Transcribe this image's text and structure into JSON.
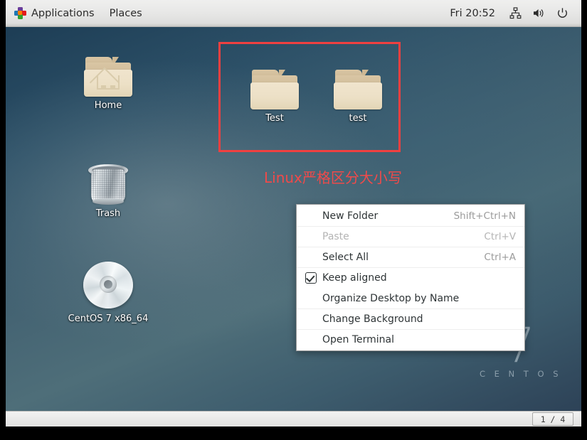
{
  "top_panel": {
    "applications_label": "Applications",
    "places_label": "Places",
    "clock": "Fri 20:52",
    "tray": [
      {
        "name": "network-icon",
        "title": "Network"
      },
      {
        "name": "volume-icon",
        "title": "Volume"
      },
      {
        "name": "power-icon",
        "title": "Power"
      }
    ]
  },
  "desktop": {
    "icons": [
      {
        "name": "home",
        "label": "Home",
        "type": "folder-home"
      },
      {
        "name": "trash",
        "label": "Trash",
        "type": "trash"
      },
      {
        "name": "centos-disc",
        "label": "CentOS 7 x86_64",
        "type": "cd"
      },
      {
        "name": "test-upper",
        "label": "Test",
        "type": "folder"
      },
      {
        "name": "test-lower",
        "label": "test",
        "type": "folder"
      }
    ],
    "annotation": {
      "text": "Linux严格区分大小写",
      "color": "#f04a4a",
      "rect_color": "#f04040"
    },
    "watermark": {
      "version": "7",
      "brand": "C E N T O S"
    }
  },
  "context_menu": {
    "items": [
      {
        "label": "New Folder",
        "accel": "Shift+Ctrl+N",
        "disabled": false,
        "checkbox": null
      },
      {
        "label": "Paste",
        "accel": "Ctrl+V",
        "disabled": true,
        "checkbox": null
      },
      {
        "label": "Select All",
        "accel": "Ctrl+A",
        "disabled": false,
        "checkbox": null
      },
      {
        "label": "Keep aligned",
        "accel": "",
        "disabled": false,
        "checkbox": true
      },
      {
        "label": "Organize Desktop by Name",
        "accel": "",
        "disabled": false,
        "checkbox": null
      },
      {
        "label": "Change Background",
        "accel": "",
        "disabled": false,
        "checkbox": null
      },
      {
        "label": "Open Terminal",
        "accel": "",
        "disabled": false,
        "checkbox": null
      }
    ]
  },
  "bottom_panel": {
    "workspace_indicator": "1 / 4"
  }
}
